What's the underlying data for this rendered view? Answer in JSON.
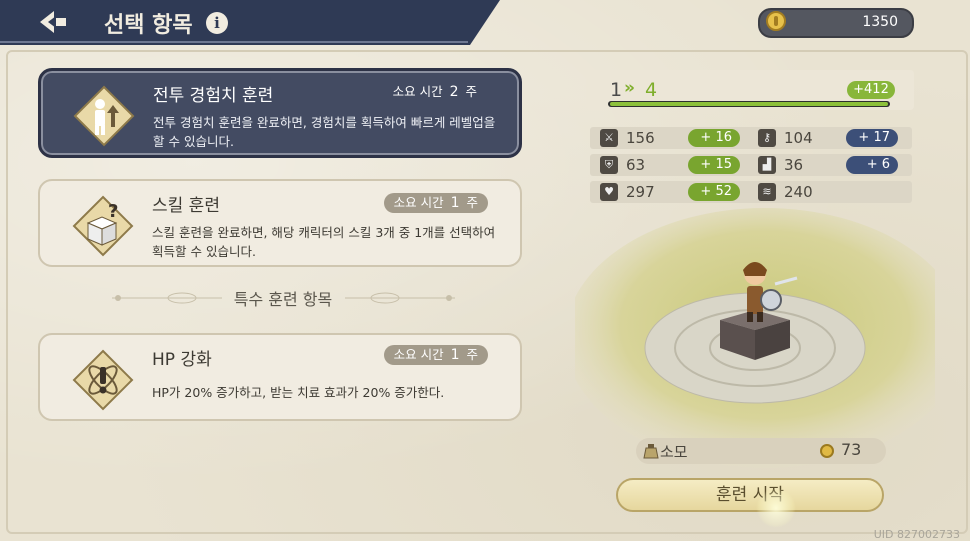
{
  "header": {
    "title": "선택 항목",
    "info_glyph": "i"
  },
  "currency": {
    "amount": "1350",
    "icon": "coin-icon"
  },
  "training_options": [
    {
      "name": "전투 경험치 훈련",
      "time_label": "소요 시간",
      "time_value": "2",
      "time_unit": "주",
      "description": "전투 경험치 훈련을 완료하면, 경험치를 획득하여 빠르게 레벨업을 할 수 있습니다.",
      "icon": "level-up-figure-icon",
      "selected": true
    },
    {
      "name": "스킬 훈련",
      "time_label": "소요 시간",
      "time_value": "1",
      "time_unit": "주",
      "description": "스킬 훈련을 완료하면, 해당 캐릭터의 스킬 3개 중 1개를 선택하여 획득할 수 있습니다.",
      "icon": "dice-question-icon",
      "selected": false
    }
  ],
  "special_section_title": "특수 훈련 항목",
  "special_options": [
    {
      "name": "HP 강화",
      "time_label": "소요 시간",
      "time_value": "1",
      "time_unit": "주",
      "description": "HP가 20% 증가하고, 받는 치료 효과가 20% 증가한다.",
      "icon": "exclamation-atom-icon",
      "selected": false
    }
  ],
  "level": {
    "from": "1",
    "arrow": "»",
    "to": "4",
    "exp_gain": "+412",
    "progress": 1.0
  },
  "stats": [
    {
      "icon": "sword-icon",
      "value": "156",
      "bonus": "+ 16",
      "bonus_color": "green"
    },
    {
      "icon": "key-icon",
      "value": "104",
      "bonus": "+ 17",
      "bonus_color": "blue"
    },
    {
      "icon": "shield-icon",
      "value": "63",
      "bonus": "+ 15",
      "bonus_color": "green"
    },
    {
      "icon": "boot-icon",
      "value": "36",
      "bonus": "+ 6",
      "bonus_color": "blue"
    },
    {
      "icon": "heart-icon",
      "value": "297",
      "bonus": "+ 52",
      "bonus_color": "green"
    },
    {
      "icon": "wing-icon",
      "value": "240",
      "bonus": "",
      "bonus_color": ""
    }
  ],
  "cost": {
    "label": "소모",
    "value": "73"
  },
  "start_button": "훈련 시작",
  "uid": "UID 827002733",
  "colors": {
    "header_navy": "#2f3a55",
    "selected_card": "#434b62",
    "accent_green": "#79a52f",
    "accent_blue": "#3c4f78"
  }
}
